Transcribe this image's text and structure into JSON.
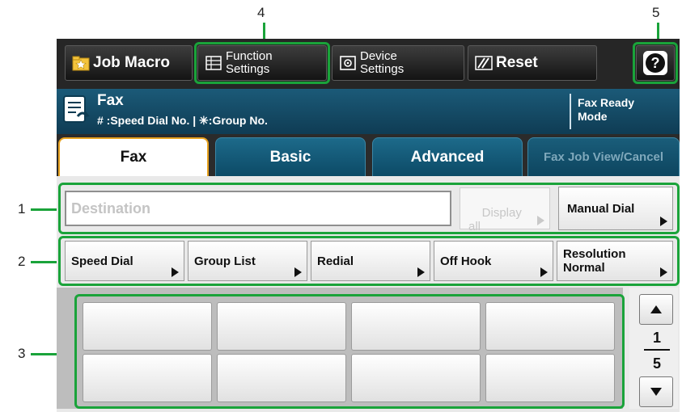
{
  "callouts": [
    "4",
    "5",
    "1",
    "2",
    "3"
  ],
  "toolbar": {
    "job_macro": "Job Macro",
    "function_settings": "Function\nSettings",
    "device_settings": "Device\nSettings",
    "reset": "Reset",
    "help": "?"
  },
  "title": {
    "mode": "Fax",
    "hint": "# :Speed Dial No. | ✳:Group No.",
    "status": "Fax Ready\nMode"
  },
  "tabs": [
    {
      "label": "Fax",
      "active": true
    },
    {
      "label": "Basic",
      "active": false
    },
    {
      "label": "Advanced",
      "active": false
    },
    {
      "label": "Fax Job View/Cancel",
      "active": false,
      "disabled": true
    }
  ],
  "destination": {
    "placeholder": "Destination",
    "display_all": "Display\nall",
    "manual_dial": "Manual Dial"
  },
  "functions": [
    {
      "label": "Speed Dial"
    },
    {
      "label": "Group List"
    },
    {
      "label": "Redial"
    },
    {
      "label": "Off Hook"
    },
    {
      "label": "Resolution\nNormal"
    }
  ],
  "pager": {
    "current": "1",
    "total": "5"
  },
  "colors": {
    "highlight": "#1aa33a",
    "active_tab_border": "#e7a21f",
    "title_bar": "#1b5a78"
  }
}
